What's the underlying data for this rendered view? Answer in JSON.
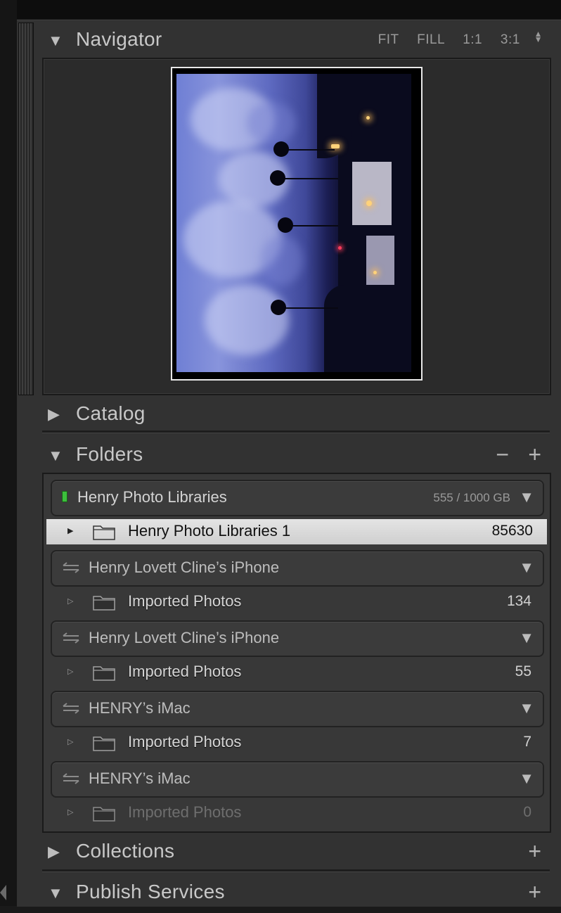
{
  "navigator": {
    "title": "Navigator",
    "zoom_options": [
      "FIT",
      "FILL",
      "1:1",
      "3:1"
    ]
  },
  "catalog": {
    "title": "Catalog"
  },
  "folders": {
    "title": "Folders",
    "minus_label": "−",
    "plus_label": "+",
    "volumes": [
      {
        "name": "Henry Photo Libraries",
        "capacity": "555 / 1000 GB",
        "type": "local",
        "folders": [
          {
            "name": "Henry Photo Libraries 1",
            "count": "85630",
            "selected": true
          }
        ]
      },
      {
        "name": "Henry Lovett Cline’s iPhone",
        "type": "remote",
        "folders": [
          {
            "name": "Imported Photos",
            "count": "134"
          }
        ]
      },
      {
        "name": "Henry Lovett Cline’s iPhone",
        "type": "remote",
        "folders": [
          {
            "name": "Imported Photos",
            "count": "55"
          }
        ]
      },
      {
        "name": "HENRY’s iMac",
        "type": "remote",
        "folders": [
          {
            "name": "Imported Photos",
            "count": "7"
          }
        ]
      },
      {
        "name": "HENRY’s iMac",
        "type": "remote",
        "folders": [
          {
            "name": "Imported Photos",
            "count": "0",
            "dimmed": true
          }
        ]
      }
    ]
  },
  "collections": {
    "title": "Collections",
    "plus_label": "+"
  },
  "publish_services": {
    "title": "Publish Services",
    "plus_label": "+"
  },
  "colors": {
    "panel_bg": "#323232",
    "selected_row": "#dcdcdc",
    "volume_indicator": "#3cbf3c"
  }
}
